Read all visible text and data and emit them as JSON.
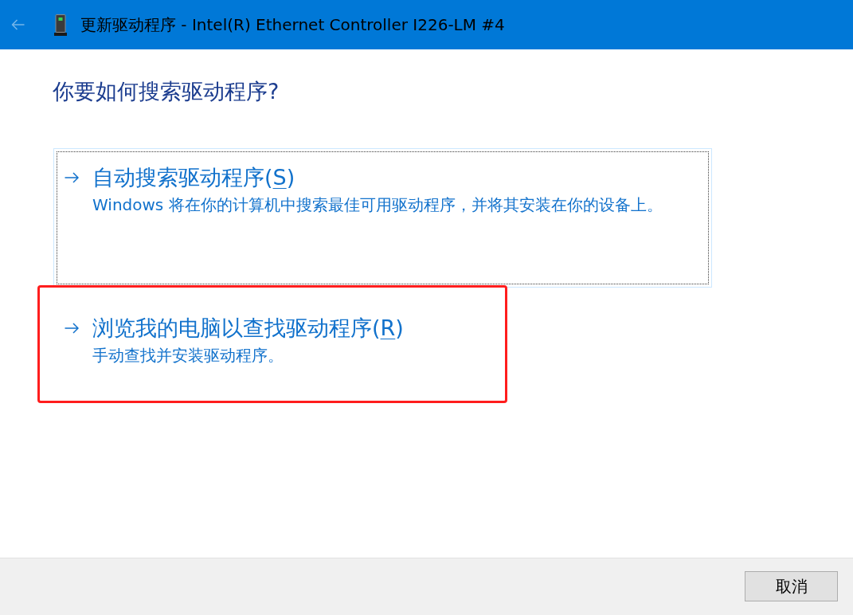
{
  "window": {
    "title": "更新驱动程序 - Intel(R) Ethernet Controller I226-LM #4",
    "back_button": {
      "disabled": true
    }
  },
  "heading": "你要如何搜索驱动程序?",
  "options": [
    {
      "title": {
        "text": "自动搜索驱动程序(",
        "access_key": "S",
        "text_after": ")"
      },
      "description": "Windows 将在你的计算机中搜索最佳可用驱动程序，并将其安装在你的设备上。",
      "focused": true,
      "highlighted": false
    },
    {
      "title": {
        "text": "浏览我的电脑以查找驱动程序(",
        "access_key": "R",
        "text_after": ")"
      },
      "description": "手动查找并安装驱动程序。",
      "focused": false,
      "highlighted": true
    }
  ],
  "cancel_button": {
    "label": "取消"
  }
}
